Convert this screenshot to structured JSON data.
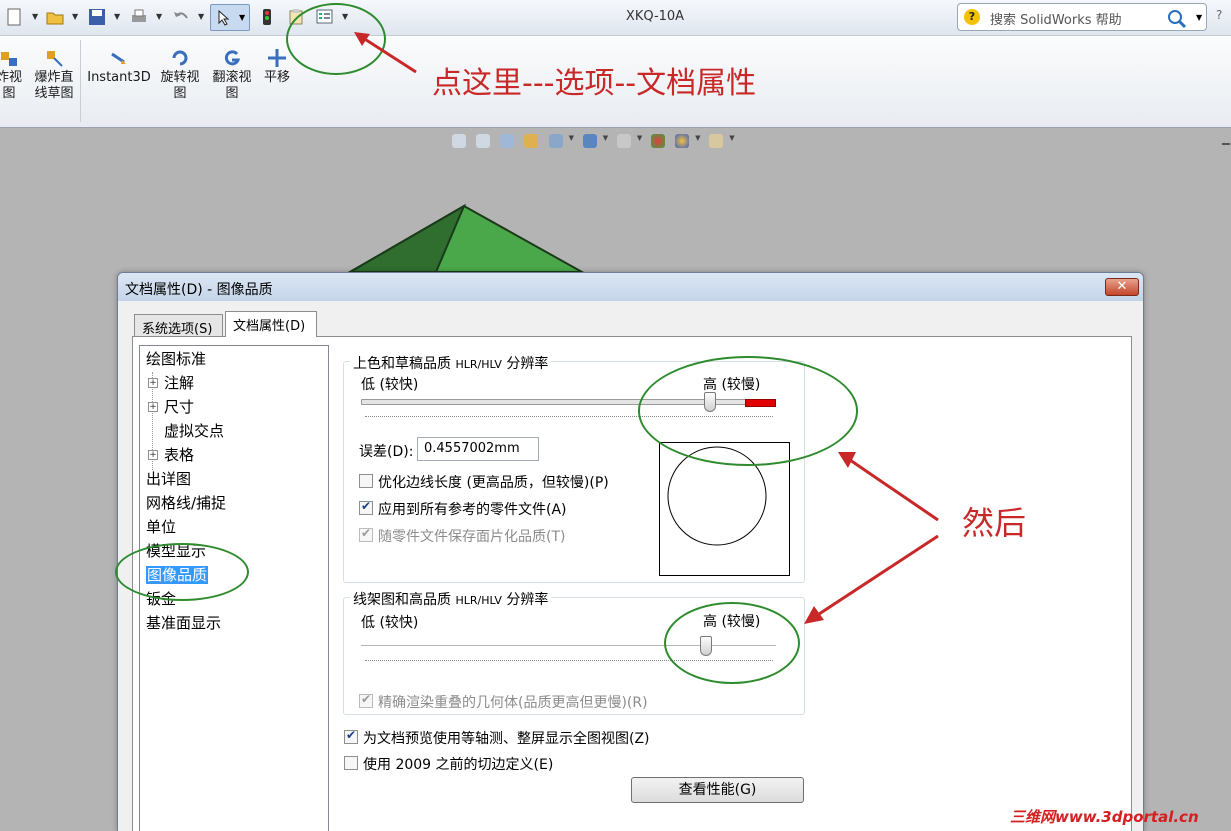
{
  "window": {
    "title": "XKQ-10A",
    "search_placeholder": "搜索 SolidWorks 帮助",
    "help_glyph": "?"
  },
  "ribbon": {
    "buttons": [
      {
        "label1": "炸视",
        "label2": "图"
      },
      {
        "label1": "爆炸直",
        "label2": "线草图"
      },
      {
        "label1": "Instant3D",
        "label2": ""
      },
      {
        "label1": "旋转视",
        "label2": "图"
      },
      {
        "label1": "翻滚视",
        "label2": "图"
      },
      {
        "label1": "平移",
        "label2": ""
      }
    ]
  },
  "annotations": {
    "top_instruction": "点这里---选项--文档属性",
    "then": "然后",
    "watermark": "三维网www.3dportal.cn"
  },
  "dialog": {
    "title": "文档属性(D) - 图像品质",
    "close_glyph": "✕",
    "tabs": [
      {
        "label": "系统选项(S)",
        "active": false
      },
      {
        "label": "文档属性(D)",
        "active": true
      }
    ],
    "tree": [
      {
        "label": "绘图标准",
        "level": 0,
        "expander": false
      },
      {
        "label": "注解",
        "level": 1,
        "expander": true
      },
      {
        "label": "尺寸",
        "level": 1,
        "expander": true
      },
      {
        "label": "虚拟交点",
        "level": 1,
        "expander": false
      },
      {
        "label": "表格",
        "level": 1,
        "expander": true
      },
      {
        "label": "出详图",
        "level": 0,
        "expander": false
      },
      {
        "label": "网格线/捕捉",
        "level": 0,
        "expander": false
      },
      {
        "label": "单位",
        "level": 0,
        "expander": false
      },
      {
        "label": "模型显示",
        "level": 0,
        "expander": false
      },
      {
        "label": "图像品质",
        "level": 0,
        "expander": false,
        "selected": true
      },
      {
        "label": "钣金",
        "level": 0,
        "expander": false
      },
      {
        "label": "基准面显示",
        "level": 0,
        "expander": false
      }
    ],
    "shaded_group": {
      "title_main": "上色和草稿品质 ",
      "title_small": "HLR/HLV",
      "title_tail": " 分辨率",
      "low_label": "低 (较快)",
      "high_label": "高 (较慢)",
      "slider_level": 0.87,
      "tolerance_label": "误差(D):",
      "tolerance_value": "0.4557002mm",
      "options": [
        {
          "label": "优化边线长度 (更高品质，但较慢)(P)",
          "checked": false,
          "disabled": false
        },
        {
          "label": "应用到所有参考的零件文件(A)",
          "checked": true,
          "disabled": false
        },
        {
          "label": "随零件文件保存面片化品质(T)",
          "checked": true,
          "disabled": true
        }
      ]
    },
    "wire_group": {
      "title_main": "线架图和高品质 ",
      "title_small": "HLR/HLV",
      "title_tail": " 分辨率",
      "low_label": "低 (较快)",
      "high_label": "高 (较慢)",
      "slider_level": 0.86,
      "options": [
        {
          "label": "精确渲染重叠的几何体(品质更高但更慢)(R)",
          "checked": true,
          "disabled": true
        }
      ]
    },
    "bottom_options": [
      {
        "label": "为文档预览使用等轴测、整屏显示全图视图(Z)",
        "checked": true
      },
      {
        "label": "使用 2009 之前的切边定义(E)",
        "checked": false
      }
    ],
    "perf_button": "查看性能(G)"
  },
  "colors": {
    "annotation": "#c82828",
    "highlight_ellipse": "#2e8b2e",
    "selection": "#3399ff",
    "slider_high_zone": "#e00000",
    "model_green": "#4aa84a"
  }
}
